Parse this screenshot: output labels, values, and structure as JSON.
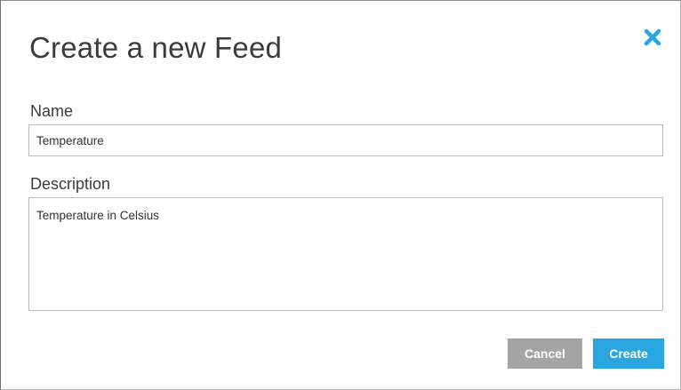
{
  "dialog": {
    "title": "Create a new Feed",
    "close_icon": "close-icon",
    "accent_color": "#29a6e0"
  },
  "form": {
    "name_label": "Name",
    "name_value": "Temperature",
    "description_label": "Description",
    "description_value": "Temperature in Celsius"
  },
  "buttons": {
    "cancel_label": "Cancel",
    "create_label": "Create",
    "cancel_color": "#a4a4a4",
    "create_color": "#29a6e0"
  }
}
